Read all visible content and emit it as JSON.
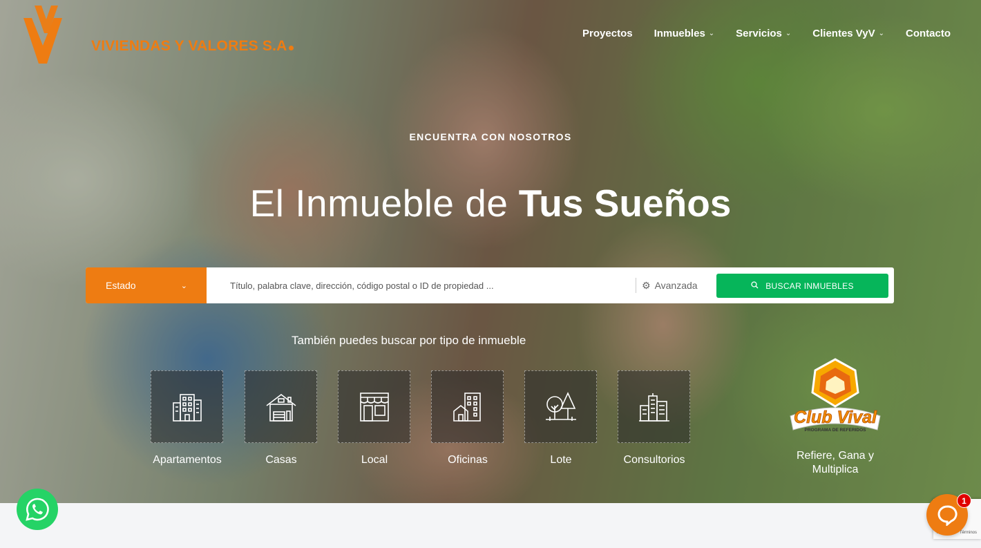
{
  "brand": {
    "name": "VIVIENDAS Y VALORES S.A",
    "accent": "#ee7c12"
  },
  "nav": {
    "items": [
      {
        "label": "Proyectos",
        "dropdown": false
      },
      {
        "label": "Inmuebles",
        "dropdown": true
      },
      {
        "label": "Servicios",
        "dropdown": true
      },
      {
        "label": "Clientes VyV",
        "dropdown": true
      },
      {
        "label": "Contacto",
        "dropdown": false
      }
    ]
  },
  "hero": {
    "kicker": "ENCUENTRA CON NOSOTROS",
    "headline_light": "El Inmueble de",
    "headline_bold": "Tus Sueños",
    "subtitle": "También puedes buscar por tipo de inmueble"
  },
  "search": {
    "state_label": "Estado",
    "placeholder": "Título, palabra clave, dirección, código postal o ID de propiedad ...",
    "advanced_label": "Avanzada",
    "button_label": "BUSCAR INMUEBLES",
    "button_color": "#06b55a"
  },
  "categories": [
    {
      "label": "Apartamentos",
      "icon": "apartment-building-icon"
    },
    {
      "label": "Casas",
      "icon": "house-icon"
    },
    {
      "label": "Local",
      "icon": "storefront-icon"
    },
    {
      "label": "Oficinas",
      "icon": "office-building-icon"
    },
    {
      "label": "Lote",
      "icon": "land-lot-trees-icon"
    },
    {
      "label": "Consultorios",
      "icon": "city-buildings-icon"
    }
  ],
  "club": {
    "logo_text": "Club Vival",
    "logo_subtext": "PROGRAMA DE REFERIDOS",
    "caption": "Refiere, Gana y Multiplica"
  },
  "chat": {
    "badge_count": "1"
  },
  "recaptcha": {
    "text": "Privacidad - Términos"
  }
}
